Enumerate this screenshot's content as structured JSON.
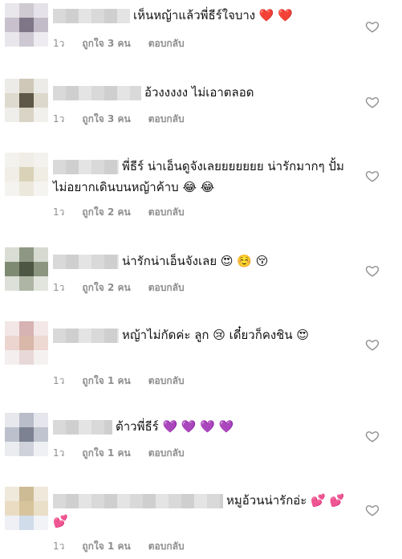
{
  "comments": [
    {
      "text": "เห็นหญ้าแล้วพี่ธีร์ใจบาง",
      "emojis": "❤️ ❤️",
      "time": "1ว",
      "likes": "ถูกใจ 3 คน",
      "reply": "ตอบกลับ"
    },
    {
      "text": "อ้วงงงงง ไม่เอาตลอด",
      "emojis": "",
      "time": "1ว",
      "likes": "ถูกใจ 3 คน",
      "reply": "ตอบกลับ"
    },
    {
      "text": "พี่ธีร์ น่าเอ็นดูจังเลยยยยยยย น่ารักมากๆ ปั้มไม่อยากเดินบนหญ้าค้าบ",
      "emojis": "😂 😂",
      "time": "1ว",
      "likes": "ถูกใจ 2 คน",
      "reply": "ตอบกลับ"
    },
    {
      "text": "น่ารักน่าเอ็นจังเลย",
      "emojis": "😍 ☺️ 😚",
      "time": "1ว",
      "likes": "ถูกใจ 2 คน",
      "reply": "ตอบกลับ"
    },
    {
      "text": "หญ้าไม่กัดค่ะ ลูก 😢 เดี๋ยวก็คงชิน",
      "emojis": "😍",
      "time": "1ว",
      "likes": "ถูกใจ 1 คน",
      "reply": "ตอบกลับ"
    },
    {
      "text": "ต้าวพี่ธีร์",
      "emojis": "💜 💜 💜 💜",
      "time": "1ว",
      "likes": "ถูกใจ 1 คน",
      "reply": "ตอบกลับ"
    },
    {
      "text": "หมูอ้วนน่ารักอ่ะ",
      "emojis": "💕 💕 💕",
      "time": "1ว",
      "likes": "ถูกใจ 1 คน",
      "reply": "ตอบกลับ"
    }
  ],
  "colors": {
    "meta_text": "#8e8e8e",
    "text": "#111111",
    "background": "#ffffff"
  },
  "icons": {
    "like": "heart-outline-icon"
  }
}
